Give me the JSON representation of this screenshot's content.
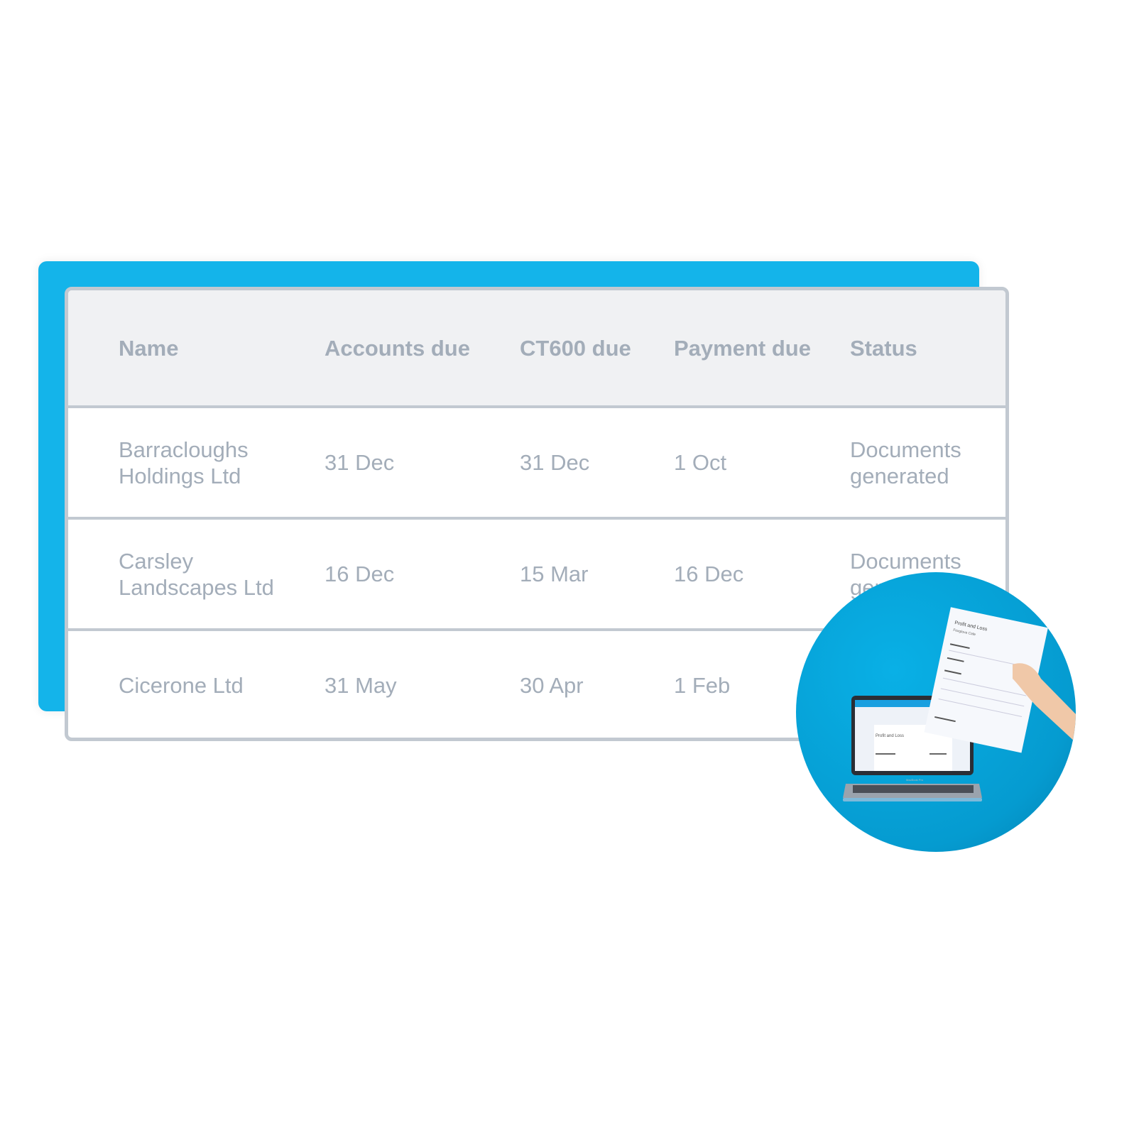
{
  "table": {
    "headers": [
      "Name",
      "Accounts due",
      "CT600 due",
      "Payment due",
      "Status"
    ],
    "rows": [
      [
        "Barracloughs Holdings Ltd",
        "31 Dec",
        "31 Dec",
        "1 Oct",
        "Documents generated"
      ],
      [
        "Carsley Landscapes Ltd",
        "16 Dec",
        "15 Mar",
        "16 Dec",
        "Documents generated"
      ],
      [
        "Cicerone Ltd",
        "31 May",
        "30 Apr",
        "1 Feb",
        ""
      ]
    ]
  },
  "photo": {
    "paper_title": "Profit and Loss",
    "paper_subtitle": "Foxglove Cafe",
    "laptop_brand": "MacBook Pro"
  },
  "colors": {
    "accent": "#14b4ea",
    "border": "#c2c9d1",
    "text": "#a3adb9",
    "header_bg": "#f0f1f3"
  }
}
